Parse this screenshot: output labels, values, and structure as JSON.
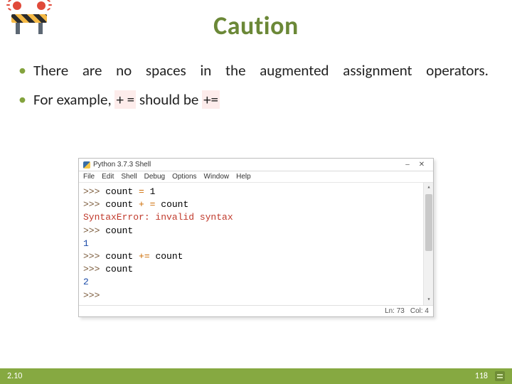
{
  "title": "Caution",
  "bullets": {
    "b1_words": [
      "There",
      "are",
      "no",
      "spaces",
      "in",
      "the",
      "augmented",
      "assignment",
      "operators."
    ],
    "b2_pre": "For example, ",
    "b2_wrong": "+ =",
    "b2_mid": " should be ",
    "b2_right": "+="
  },
  "shell": {
    "title": "Python 3.7.3 Shell",
    "winbtn_min": "‒",
    "winbtn_close": "✕",
    "menus": [
      "File",
      "Edit",
      "Shell",
      "Debug",
      "Options",
      "Window",
      "Help"
    ],
    "lines": [
      {
        "seg": [
          [
            "p-prompt",
            ">>> "
          ],
          [
            "p-black",
            "count "
          ],
          [
            "p-orange",
            "="
          ],
          [
            "p-black",
            " 1"
          ]
        ]
      },
      {
        "seg": [
          [
            "p-prompt",
            ">>> "
          ],
          [
            "p-black",
            "count "
          ],
          [
            "p-orange",
            "+"
          ],
          [
            "p-black",
            " "
          ],
          [
            "p-orange",
            "="
          ],
          [
            "p-black",
            " count"
          ]
        ]
      },
      {
        "seg": [
          [
            "p-err",
            "SyntaxError: invalid syntax"
          ]
        ]
      },
      {
        "seg": [
          [
            "p-prompt",
            ">>> "
          ],
          [
            "p-black",
            "count"
          ]
        ]
      },
      {
        "seg": [
          [
            "p-blue",
            "1"
          ]
        ]
      },
      {
        "seg": [
          [
            "p-prompt",
            ">>> "
          ],
          [
            "p-black",
            "count "
          ],
          [
            "p-orange",
            "+="
          ],
          [
            "p-black",
            " count"
          ]
        ]
      },
      {
        "seg": [
          [
            "p-prompt",
            ">>> "
          ],
          [
            "p-black",
            "count"
          ]
        ]
      },
      {
        "seg": [
          [
            "p-blue",
            "2"
          ]
        ]
      },
      {
        "seg": [
          [
            "p-prompt",
            ">>> "
          ]
        ]
      }
    ],
    "status_ln": "Ln: 73",
    "status_col": "Col: 4"
  },
  "footer": {
    "section": "2.10",
    "page": "118"
  }
}
